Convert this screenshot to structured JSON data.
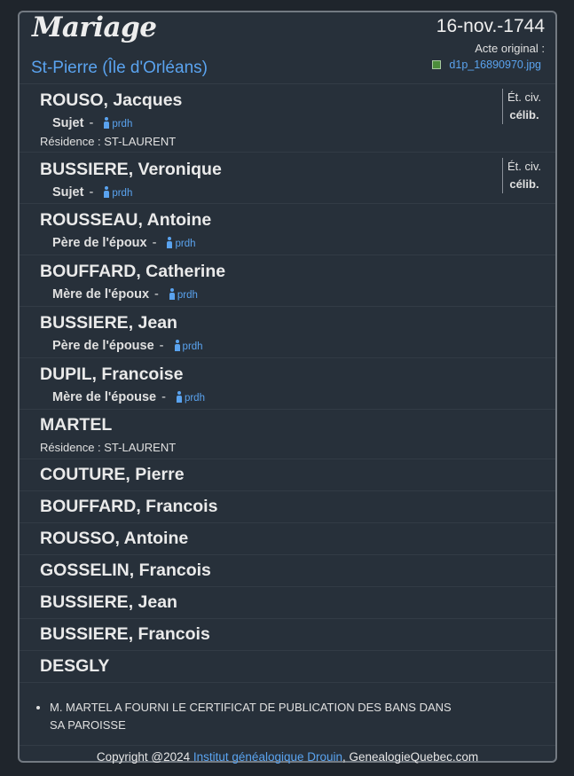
{
  "header": {
    "title": "Mariage",
    "parish": "St-Pierre (Île d'Orléans)",
    "date": "16-nov.-1744",
    "acte_label": "Acte original :",
    "acte_file": "d1p_16890970.jpg"
  },
  "persons": [
    {
      "name": "ROUSO, Jacques",
      "role": "Sujet",
      "prdh": "prdh",
      "residence": "Résidence : ST-LAURENT",
      "etat_label": "Ét. civ.",
      "etat_value": "célib."
    },
    {
      "name": "BUSSIERE, Veronique",
      "role": "Sujet",
      "prdh": "prdh",
      "etat_label": "Ét. civ.",
      "etat_value": "célib."
    },
    {
      "name": "ROUSSEAU, Antoine",
      "role": "Père de l'époux",
      "prdh": "prdh"
    },
    {
      "name": "BOUFFARD, Catherine",
      "role": "Mère de l'époux",
      "prdh": "prdh"
    },
    {
      "name": "BUSSIERE, Jean",
      "role": "Père de l'épouse",
      "prdh": "prdh"
    },
    {
      "name": "DUPIL, Francoise",
      "role": "Mère de l'épouse",
      "prdh": "prdh"
    },
    {
      "name": "MARTEL",
      "residence": "Résidence : ST-LAURENT"
    },
    {
      "name": "COUTURE, Pierre"
    },
    {
      "name": "BOUFFARD, Francois"
    },
    {
      "name": "ROUSSO, Antoine"
    },
    {
      "name": "GOSSELIN, Francois"
    },
    {
      "name": "BUSSIERE, Jean"
    },
    {
      "name": "BUSSIERE, Francois"
    },
    {
      "name": "DESGLY"
    }
  ],
  "notes": [
    "M. MARTEL A FOURNI LE CERTIFICAT DE PUBLICATION DES BANS DANS SA PAROISSE"
  ],
  "footer": {
    "prefix": "Copyright @2024 ",
    "link": "Institut généalogique Drouin",
    "suffix": ", GenealogieQuebec.com"
  },
  "colors": {
    "background": "#1f252c",
    "card": "#27303a",
    "link": "#5aa3ef",
    "text": "#e6e6e6"
  },
  "icons": {
    "person": "person-icon",
    "image_file": "image-file-icon"
  }
}
